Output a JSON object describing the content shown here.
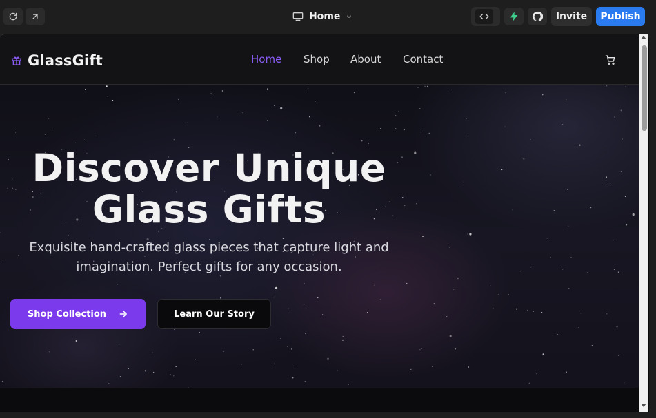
{
  "editor": {
    "refresh_icon": "refresh-icon",
    "open_external_icon": "arrow-up-right-icon",
    "page_selector": {
      "icon": "monitor-icon",
      "label": "Home",
      "chevron": "chevron-down-icon"
    },
    "code_icon": "code-icon",
    "supabase_icon": "bolt-icon",
    "github_icon": "github-icon",
    "invite_label": "Invite",
    "publish_label": "Publish",
    "colors": {
      "publish": "#2a7bf0",
      "supabase": "#3ecf8e"
    }
  },
  "site": {
    "brand": {
      "icon": "gift-icon",
      "name": "GlassGift"
    },
    "nav": {
      "items": [
        {
          "label": "Home",
          "active": true
        },
        {
          "label": "Shop",
          "active": false
        },
        {
          "label": "About",
          "active": false
        },
        {
          "label": "Contact",
          "active": false
        }
      ],
      "cart_icon": "shopping-cart-icon"
    },
    "hero": {
      "title_line1": "Discover Unique",
      "title_line2": "Glass Gifts",
      "subtitle_line1": "Exquisite hand-crafted glass pieces that capture light and",
      "subtitle_line2": "imagination. Perfect gifts for any occasion.",
      "primary_cta": "Shop Collection",
      "primary_cta_icon": "arrow-right-icon",
      "secondary_cta": "Learn Our Story"
    },
    "colors": {
      "accent": "#7c3aed",
      "accent_text": "#8b5cf6"
    }
  }
}
